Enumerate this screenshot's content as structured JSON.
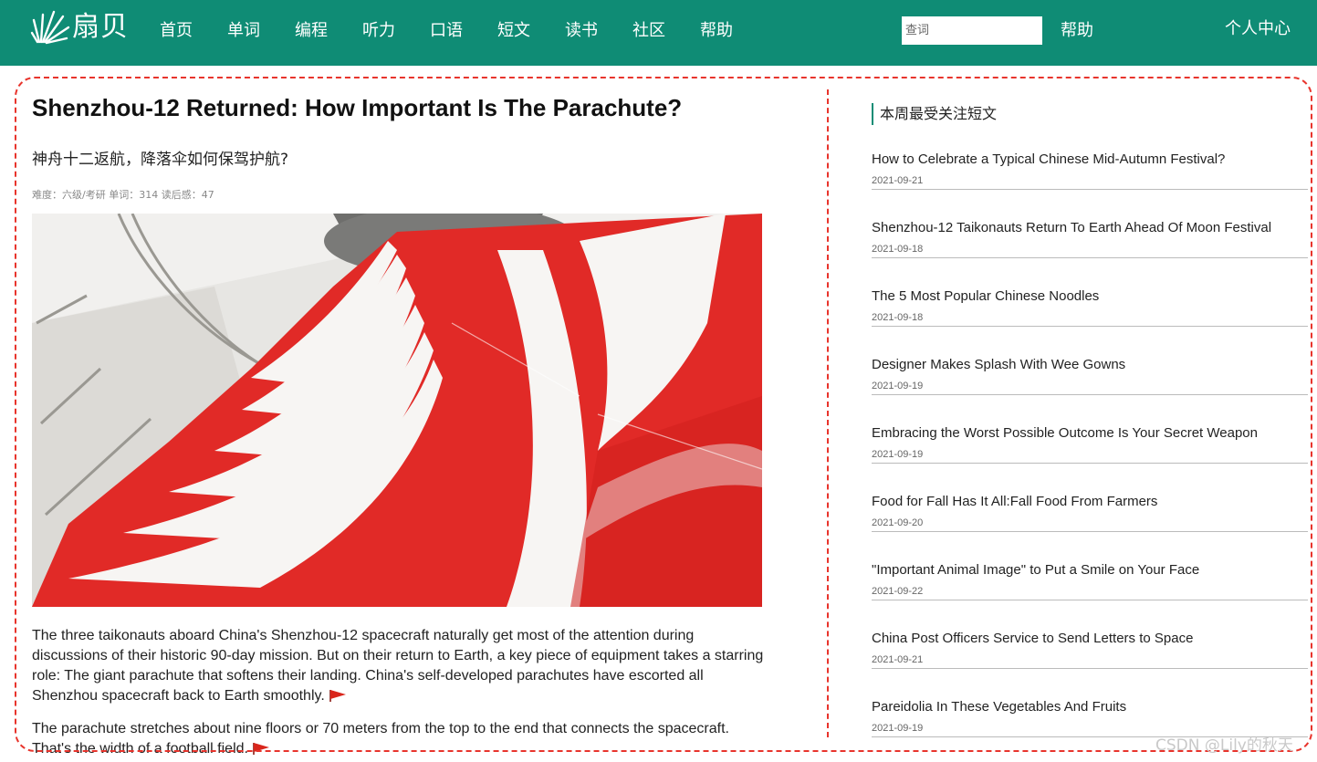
{
  "brand": {
    "logo_text": "扇贝"
  },
  "nav": {
    "items": [
      "首页",
      "单词",
      "编程",
      "听力",
      "口语",
      "短文",
      "读书",
      "社区",
      "帮助"
    ],
    "search_placeholder": "查词",
    "help_label": "帮助",
    "personal_center": "个人中心"
  },
  "article": {
    "title": "Shenzhou-12 Returned: How Important Is The Parachute?",
    "subtitle": "神舟十二返航，降落伞如何保驾护航?",
    "meta": "难度：六级/考研 单词：314 读后感：47",
    "paragraphs": [
      "The three taikonauts aboard China's Shenzhou-12 spacecraft naturally get most of the attention during discussions of their historic 90-day mission. But on their return to Earth, a key piece of equipment takes a starring role: The giant parachute that softens their landing. China's self-developed parachutes have escorted all Shenzhou spacecraft back to Earth smoothly.",
      "The parachute stretches about nine floors or 70 meters from the top to the end that connects the spacecraft. That's the width of a football field."
    ]
  },
  "sidebar": {
    "heading": "本周最受关注短文",
    "items": [
      {
        "title": "How to Celebrate a Typical Chinese Mid-Autumn Festival?",
        "date": "2021-09-21"
      },
      {
        "title": "Shenzhou-12 Taikonauts Return To Earth Ahead Of Moon Festival",
        "date": "2021-09-18"
      },
      {
        "title": "The 5 Most Popular Chinese Noodles",
        "date": "2021-09-18"
      },
      {
        "title": "Designer Makes Splash With Wee Gowns",
        "date": "2021-09-19"
      },
      {
        "title": "Embracing the Worst Possible Outcome Is Your Secret Weapon",
        "date": "2021-09-19"
      },
      {
        "title": "Food for Fall Has It All:Fall Food From Farmers",
        "date": "2021-09-20"
      },
      {
        "title": "\"Important Animal Image\" to Put a Smile on Your Face",
        "date": "2021-09-22"
      },
      {
        "title": "China Post Officers Service to Send Letters to Space",
        "date": "2021-09-21"
      },
      {
        "title": "Pareidolia In These Vegetables And Fruits",
        "date": "2021-09-19"
      }
    ]
  },
  "watermark": "CSDN @Lily的秋天",
  "colors": {
    "brand_green": "#0f8c75",
    "annotation_red": "#e8342c",
    "flag_red": "#d9261c"
  },
  "icons": {
    "paragraph_marker": "red-flag-icon",
    "logo": "shell-burst-icon"
  }
}
